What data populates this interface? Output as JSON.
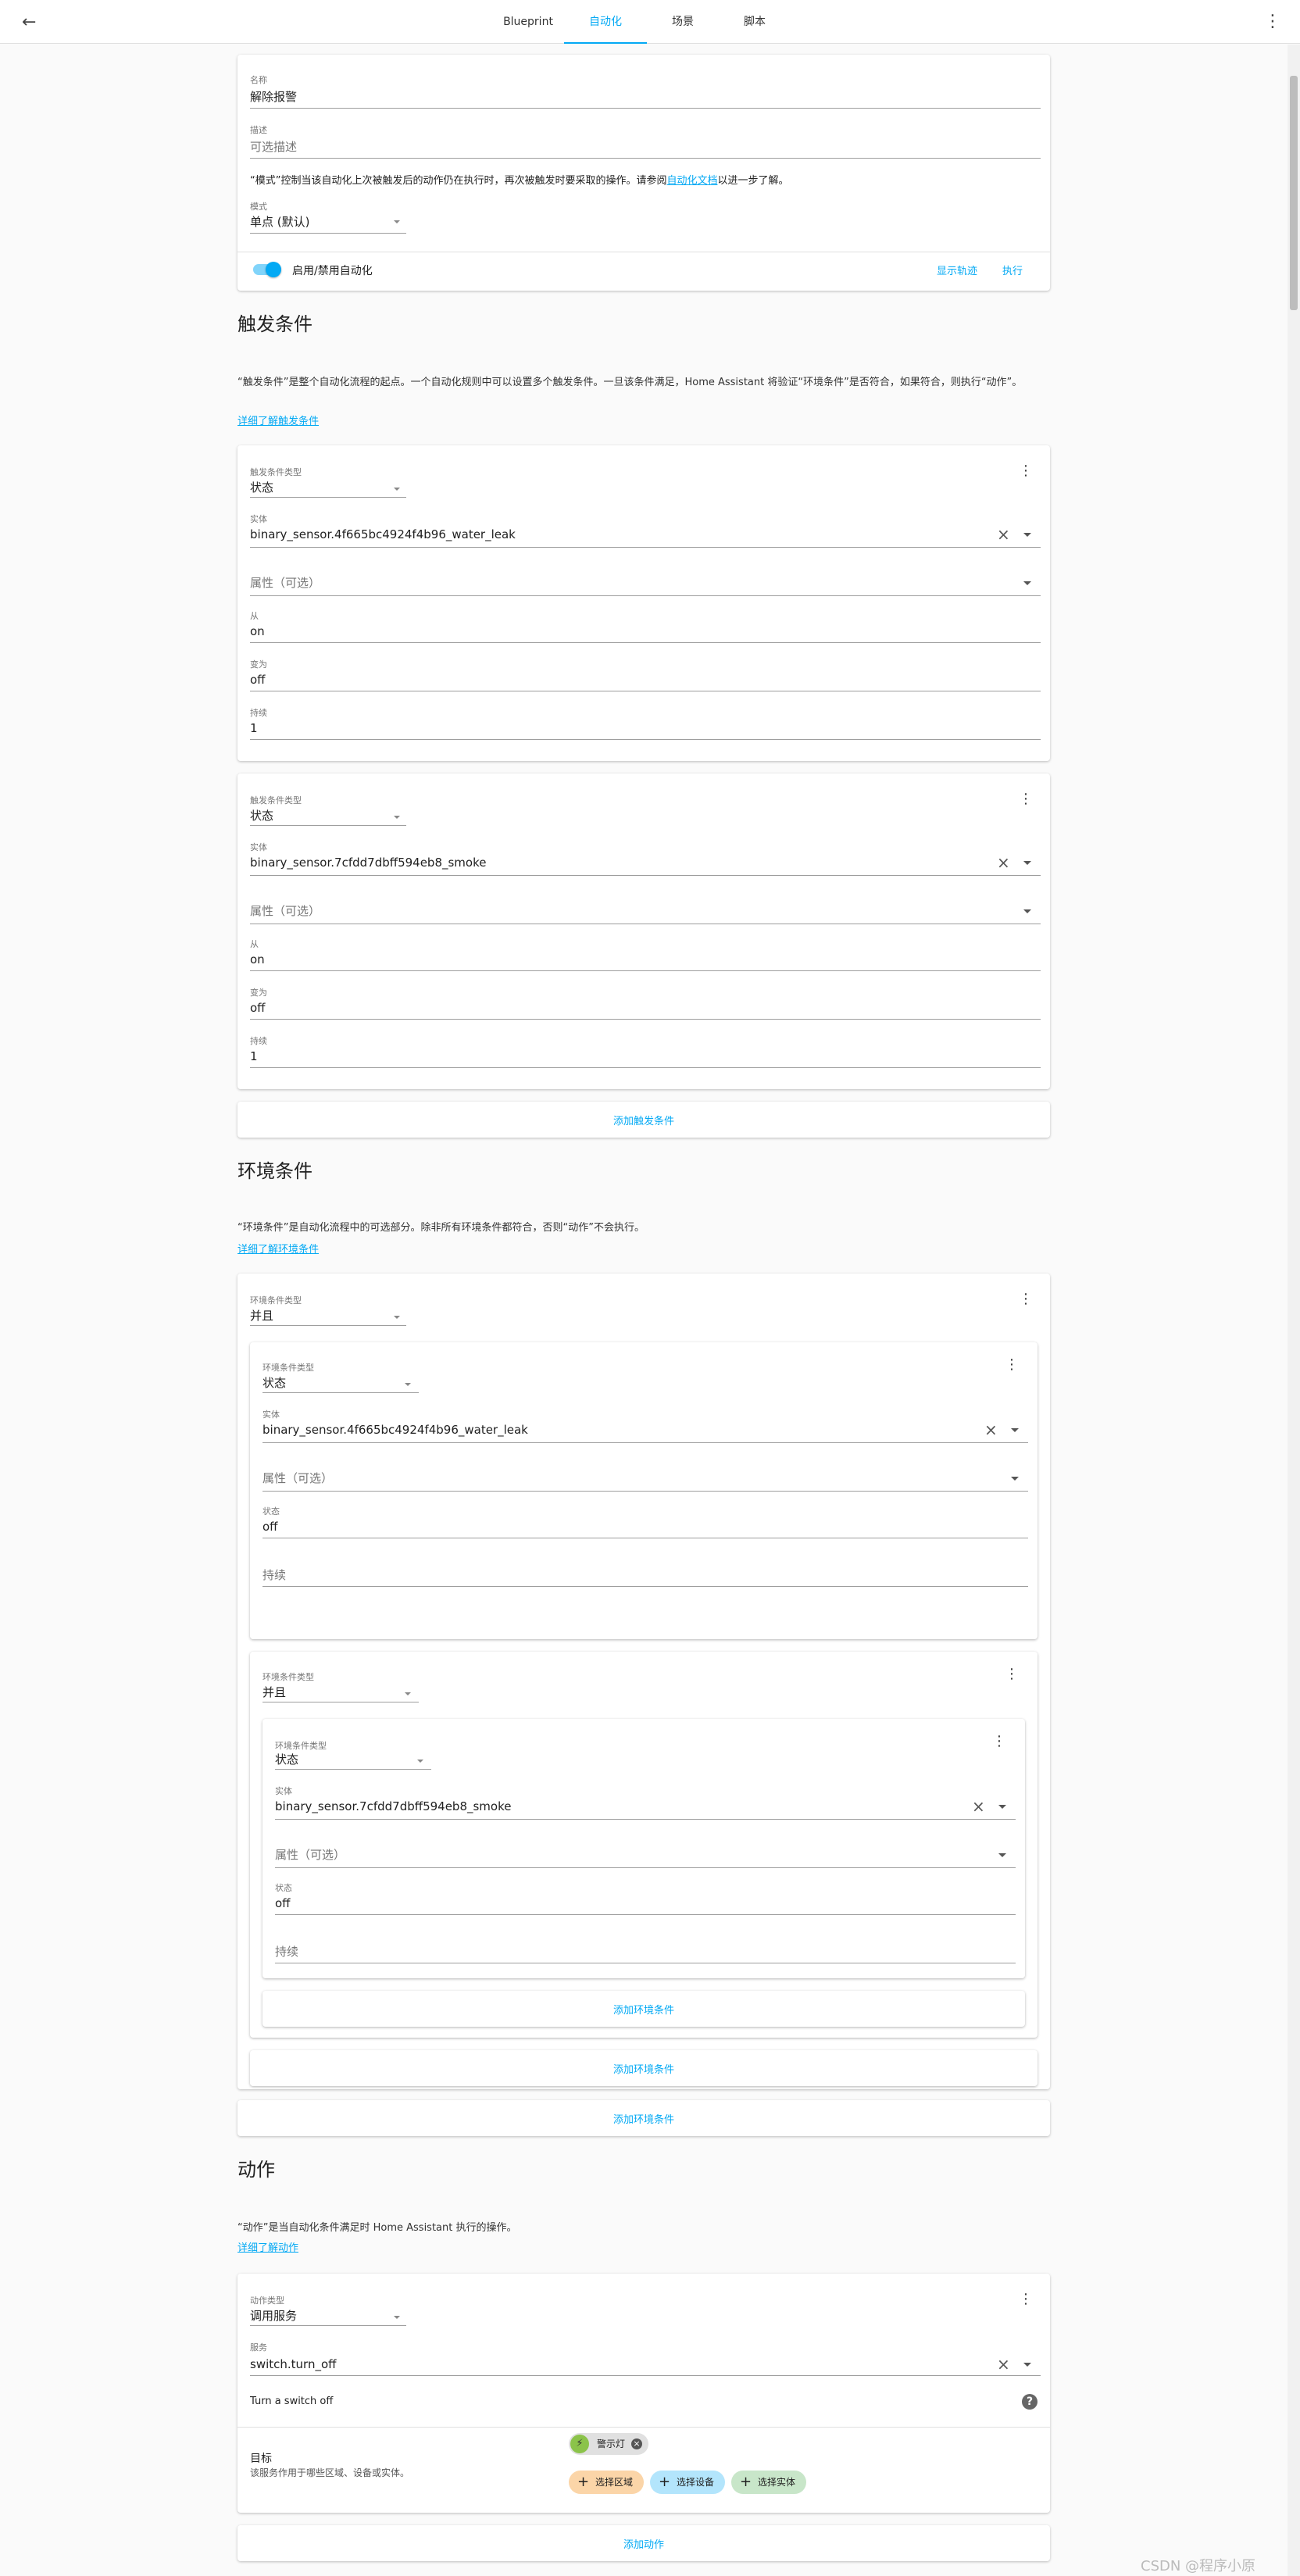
{
  "header": {
    "tabs": [
      "Blueprint",
      "自动化",
      "场景",
      "脚本"
    ]
  },
  "settings": {
    "name_label": "名称",
    "name_value": "解除报警",
    "desc_label": "描述",
    "desc_placeholder": "可选描述",
    "mode_text_pre": "“模式”控制当该自动化上次被触发后的动作仍在执行时，再次被触发时要采取的操作。请参阅",
    "mode_link": "自动化文档",
    "mode_text_post": "以进一步了解。",
    "mode_label": "模式",
    "mode_value": "单点 (默认)",
    "toggle_label": "启用/禁用自动化",
    "show_trace": "显示轨迹",
    "run": "执行"
  },
  "triggers": {
    "title": "触发条件",
    "intro": "“触发条件”是整个自动化流程的起点。一个自动化规则中可以设置多个触发条件。一旦该条件满足，Home Assistant 将验证“环境条件”是否符合，如果符合，则执行“动作”。",
    "learn_more": "详细了解触发条件",
    "add": "添加触发条件",
    "items": [
      {
        "type_label": "触发条件类型",
        "type_value": "状态",
        "entity_label": "实体",
        "entity_value": "binary_sensor.4f665bc4924f4b96_water_leak",
        "attr_placeholder": "属性（可选）",
        "from_label": "从",
        "from_value": "on",
        "to_label": "变为",
        "to_value": "off",
        "for_label": "持续",
        "for_value": "1"
      },
      {
        "type_label": "触发条件类型",
        "type_value": "状态",
        "entity_label": "实体",
        "entity_value": "binary_sensor.7cfdd7dbff594eb8_smoke",
        "attr_placeholder": "属性（可选）",
        "from_label": "从",
        "from_value": "on",
        "to_label": "变为",
        "to_value": "off",
        "for_label": "持续",
        "for_value": "1"
      }
    ]
  },
  "conditions": {
    "title": "环境条件",
    "intro": "“环境条件”是自动化流程中的可选部分。除非所有环境条件都符合，否则“动作”不会执行。",
    "learn_more": "详细了解环境条件",
    "add": "添加环境条件",
    "outer": {
      "type_label": "环境条件类型",
      "type_value": "并且",
      "add": "添加环境条件",
      "c1": {
        "type_label": "环境条件类型",
        "type_value": "状态",
        "entity_label": "实体",
        "entity_value": "binary_sensor.4f665bc4924f4b96_water_leak",
        "attr_placeholder": "属性（可选）",
        "state_label": "状态",
        "state_value": "off",
        "for_placeholder": "持续"
      },
      "c2": {
        "type_label": "环境条件类型",
        "type_value": "并且",
        "add": "添加环境条件",
        "inner": {
          "type_label": "环境条件类型",
          "type_value": "状态",
          "entity_label": "实体",
          "entity_value": "binary_sensor.7cfdd7dbff594eb8_smoke",
          "attr_placeholder": "属性（可选）",
          "state_label": "状态",
          "state_value": "off",
          "for_placeholder": "持续"
        }
      }
    }
  },
  "actions": {
    "title": "动作",
    "intro": "“动作”是当自动化条件满足时 Home Assistant 执行的操作。",
    "learn_more": "详细了解动作",
    "add": "添加动作",
    "item": {
      "type_label": "动作类型",
      "type_value": "调用服务",
      "service_label": "服务",
      "service_value": "switch.turn_off",
      "service_desc": "Turn a switch off",
      "target_label": "目标",
      "target_desc": "该服务作用于哪些区域、设备或实体。",
      "chip_entity": "警示灯",
      "chip_area": "选择区域",
      "chip_device": "选择设备",
      "chip_entity_add": "选择实体"
    }
  },
  "watermark": "CSDN @程序小原",
  "colors": {
    "accent": "#03a9f4",
    "area_chip": "#fbd5a8",
    "device_chip": "#b3e5fc",
    "entity_chip": "#c8e6c9"
  }
}
